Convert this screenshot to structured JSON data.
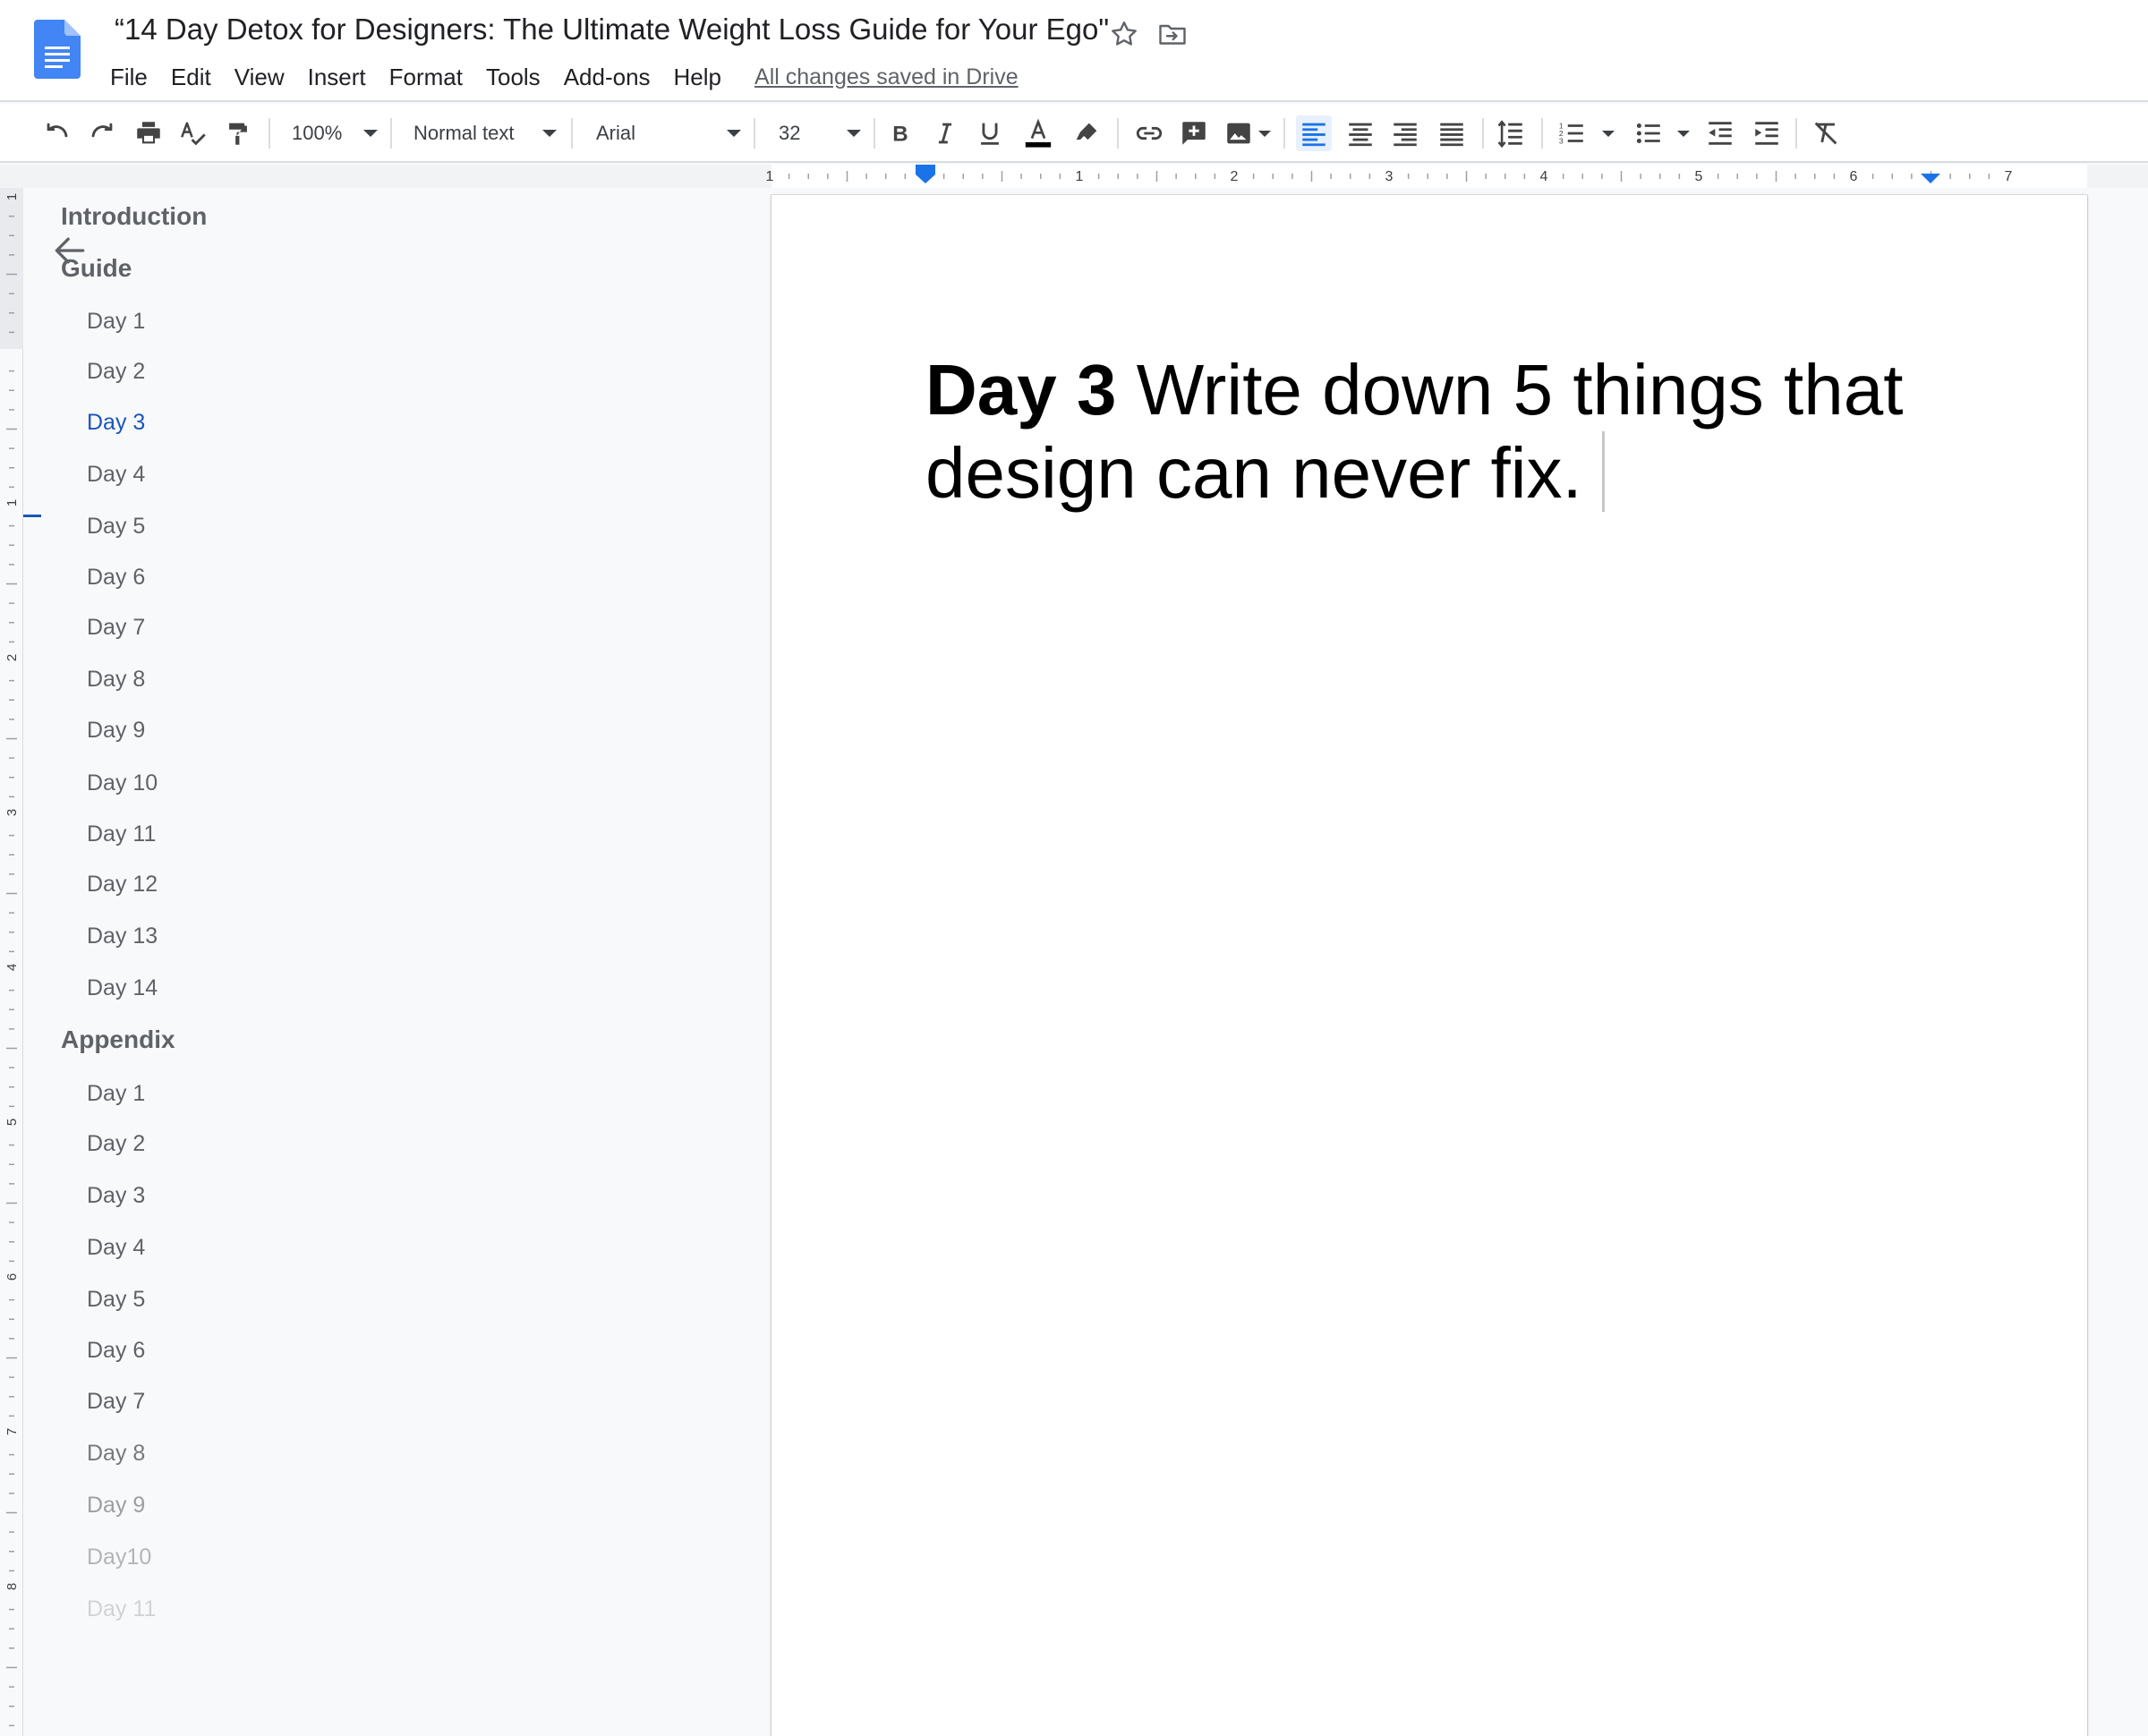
{
  "header": {
    "title": "“14 Day Detox for Designers: The Ultimate Weight Loss Guide for Your Ego\"",
    "menu": [
      "File",
      "Edit",
      "View",
      "Insert",
      "Format",
      "Tools",
      "Add-ons",
      "Help"
    ],
    "save_status": "All changes saved in Drive"
  },
  "toolbar": {
    "zoom": "100%",
    "style": "Normal text",
    "font": "Arial",
    "font_size": "32",
    "text_color": "#000000",
    "active_alignment": "left"
  },
  "ruler": {
    "horizontal_labels": [
      "1",
      "1",
      "2",
      "3",
      "4",
      "5",
      "6",
      "7"
    ],
    "vertical_labels": [
      "1",
      "1",
      "2",
      "3",
      "4",
      "5",
      "6",
      "7",
      "8"
    ]
  },
  "outline": {
    "items": [
      {
        "label": "Introduction",
        "level": 1
      },
      {
        "label": "Guide",
        "level": 1
      },
      {
        "label": "Day 1",
        "level": 2
      },
      {
        "label": "Day 2",
        "level": 2
      },
      {
        "label": "Day 3",
        "level": 2,
        "selected": true
      },
      {
        "label": "Day 4",
        "level": 2
      },
      {
        "label": "Day 5",
        "level": 2
      },
      {
        "label": "Day 6",
        "level": 2
      },
      {
        "label": "Day 7",
        "level": 2
      },
      {
        "label": "Day 8",
        "level": 2
      },
      {
        "label": "Day 9",
        "level": 2
      },
      {
        "label": "Day 10",
        "level": 2
      },
      {
        "label": "Day 11",
        "level": 2
      },
      {
        "label": "Day 12",
        "level": 2
      },
      {
        "label": "Day 13",
        "level": 2
      },
      {
        "label": "Day 14",
        "level": 2
      },
      {
        "label": "Appendix",
        "level": 1
      },
      {
        "label": "Day 1",
        "level": 2
      },
      {
        "label": "Day 2",
        "level": 2
      },
      {
        "label": "Day 3",
        "level": 2
      },
      {
        "label": "Day 4",
        "level": 2
      },
      {
        "label": "Day 5",
        "level": 2
      },
      {
        "label": "Day 6",
        "level": 2
      },
      {
        "label": "Day 7",
        "level": 2
      },
      {
        "label": "Day 8",
        "level": 2
      },
      {
        "label": "Day 9",
        "level": 2
      },
      {
        "label": "Day10",
        "level": 2
      },
      {
        "label": "Day 11",
        "level": 2
      }
    ]
  },
  "document": {
    "heading_bold": "Day 3",
    "heading_rest": " Write down 5 things that design can never fix."
  },
  "colors": {
    "accent": "#1a73e8",
    "selected_outline": "#1a56b8",
    "doc_icon": "#4285f4"
  }
}
